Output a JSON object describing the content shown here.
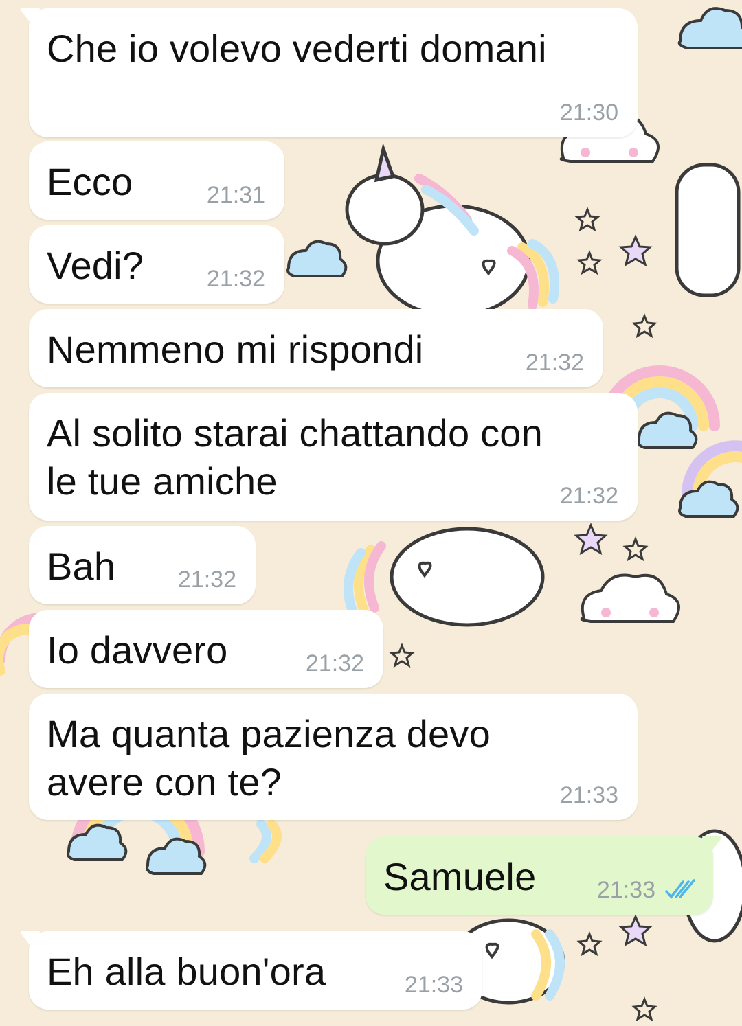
{
  "colors": {
    "wallpaper": "#f6ecd9",
    "incoming_bubble": "#ffffff",
    "outgoing_bubble": "#e2f7cb",
    "timestamp": "#9aa1a6",
    "read_ticks": "#4fb6ec"
  },
  "messages": [
    {
      "direction": "incoming",
      "text": "Che io volevo vederti domani",
      "time": "21:30"
    },
    {
      "direction": "incoming",
      "text": "Ecco",
      "time": "21:31"
    },
    {
      "direction": "incoming",
      "text": "Vedi?",
      "time": "21:32"
    },
    {
      "direction": "incoming",
      "text": "Nemmeno mi rispondi",
      "time": "21:32"
    },
    {
      "direction": "incoming",
      "text": "Al solito starai chattando con\nle tue amiche",
      "time": "21:32"
    },
    {
      "direction": "incoming",
      "text": "Bah",
      "time": "21:32"
    },
    {
      "direction": "incoming",
      "text": "Io davvero",
      "time": "21:32"
    },
    {
      "direction": "incoming",
      "text": "Ma quanta pazienza devo\navere con te?",
      "time": "21:33"
    },
    {
      "direction": "outgoing",
      "text": "Samuele",
      "time": "21:33",
      "status_icon": "double-check-read-icon"
    },
    {
      "direction": "incoming",
      "text": "Eh alla buon'ora",
      "time": "21:33"
    }
  ]
}
